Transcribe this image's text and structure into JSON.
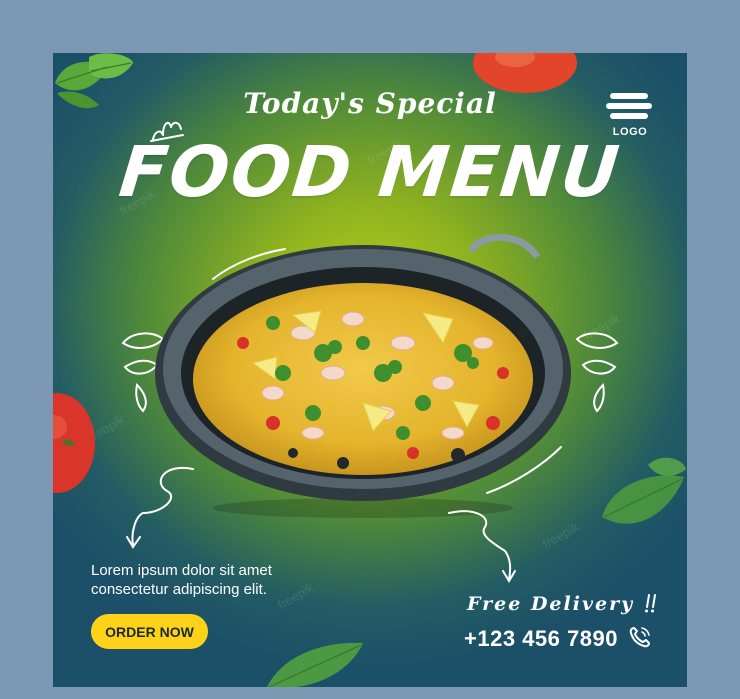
{
  "poster": {
    "subtitle": "Today's Special",
    "title": "FOOD MENU",
    "logo_label": "LOGO",
    "body_text_line1": "Lorem ipsum dolor sit amet",
    "body_text_line2": "consectetur adipiscing elit.",
    "cta_label": "ORDER NOW",
    "delivery_label": "Free Delivery",
    "phone_number": "+123 456 7890",
    "watermark": "freepik"
  },
  "colors": {
    "accent_yellow": "#ffd21a",
    "center_glow": "#b6cf1a",
    "edge_blue": "#1c4f68",
    "page_background": "#7d98b2"
  },
  "icons": [
    "logo-icon",
    "phone-icon",
    "arrow-icon",
    "leaf-icon",
    "tomato-icon",
    "pan-icon"
  ]
}
